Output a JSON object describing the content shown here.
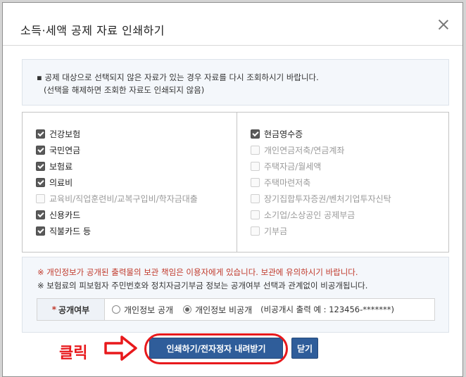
{
  "dialog": {
    "title": "소득·세액 공제 자료 인쇄하기"
  },
  "notice": {
    "line1": "▪ 공제 대상으로 선택되지 않은 자료가 있는 경우 자료를 다시 조회하시기 바랍니다.",
    "line2": "(선택을 해제하면 조회한 자료도 인쇄되지 않음)"
  },
  "left_items": [
    {
      "label": "건강보험",
      "checked": true,
      "disabled": false
    },
    {
      "label": "국민연금",
      "checked": true,
      "disabled": false
    },
    {
      "label": "보험료",
      "checked": true,
      "disabled": false
    },
    {
      "label": "의료비",
      "checked": true,
      "disabled": false
    },
    {
      "label": "교육비/직업훈련비/교복구입비/학자금대출",
      "checked": false,
      "disabled": true
    },
    {
      "label": "신용카드",
      "checked": true,
      "disabled": false
    },
    {
      "label": "직불카드 등",
      "checked": true,
      "disabled": false
    }
  ],
  "right_items": [
    {
      "label": "현금영수증",
      "checked": true,
      "disabled": false
    },
    {
      "label": "개인연금저축/연금계좌",
      "checked": false,
      "disabled": true
    },
    {
      "label": "주택자금/월세액",
      "checked": false,
      "disabled": true
    },
    {
      "label": "주택마련저축",
      "checked": false,
      "disabled": true
    },
    {
      "label": "장기집합투자증권/벤처기업투자신탁",
      "checked": false,
      "disabled": true
    },
    {
      "label": "소기업/소상공인 공제부금",
      "checked": false,
      "disabled": true
    },
    {
      "label": "기부금",
      "checked": false,
      "disabled": true
    }
  ],
  "warn": {
    "line1": "※ 개인정보가 공개된 출력물의 보관 책임은 이용자에게 있습니다. 보관에 유의하시기 바랍니다.",
    "line2": "※ 보험료의 피보험자 주민번호와 정치자금기부금 정보는 공개여부 선택과 관계없이 비공개됩니다."
  },
  "public": {
    "star": "*",
    "label": "공개여부",
    "opt_public": "개인정보 공개",
    "opt_private": "개인정보 비공개",
    "hint": "(비공개시 출력 예 : 123456-*******)"
  },
  "buttons": {
    "print": "인쇄하기/전자정자 내려받기",
    "close": "닫기"
  },
  "annotation": {
    "click_label": "클릭"
  },
  "colors": {
    "accent": "#2f5d9a",
    "warning": "#c0392b",
    "highlight": "#e8191c"
  }
}
